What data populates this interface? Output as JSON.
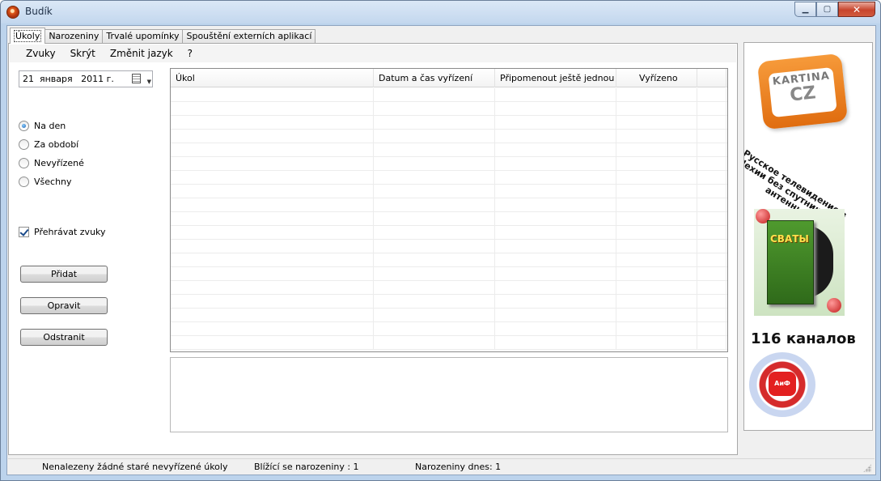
{
  "window": {
    "title": "Budík"
  },
  "tabs": [
    {
      "label": "Úkoly",
      "active": true
    },
    {
      "label": "Narozeniny"
    },
    {
      "label": "Trvalé upomínky"
    },
    {
      "label": "Spouštění externích aplikací"
    }
  ],
  "menu": [
    {
      "label": "Zvuky"
    },
    {
      "label": "Skrýt"
    },
    {
      "label": "Změnit jazyk"
    },
    {
      "label": "?"
    }
  ],
  "date_picker": {
    "value": "21  января   2011 г."
  },
  "filters": [
    {
      "label": "Na den",
      "selected": true
    },
    {
      "label": "Za období",
      "selected": false
    },
    {
      "label": "Nevyřízené",
      "selected": false
    },
    {
      "label": "Všechny",
      "selected": false
    }
  ],
  "play_sounds": {
    "label": "Přehrávat zvuky",
    "checked": true
  },
  "buttons": {
    "add": "Přidat",
    "edit": "Opravit",
    "delete": "Odstranit"
  },
  "table": {
    "columns": [
      "Úkol",
      "Datum a čas vyřízení",
      "Připomenout ještě jednou",
      "Vyřízeno"
    ],
    "rows": []
  },
  "ad": {
    "logo_line1": "KARTINA",
    "logo_line2": "CZ",
    "tagline": "Русское телевидение в Чехии без спутниковой антенны",
    "dvd_title": "СВАТЫ",
    "channels": "116 каналов",
    "badge_text": "АиФ"
  },
  "status": {
    "old_tasks": "Nenalezeny žádné staré nevyřízené úkoly",
    "upcoming_birthdays": "Blížící se narozeniny : 1",
    "birthdays_today": "Narozeniny dnes: 1"
  },
  "colors": {
    "titlebar": "#c3d7ee",
    "close_button": "#c8452d",
    "radio_selected": "#1a5fb0",
    "ad_orange": "#e06d10"
  }
}
